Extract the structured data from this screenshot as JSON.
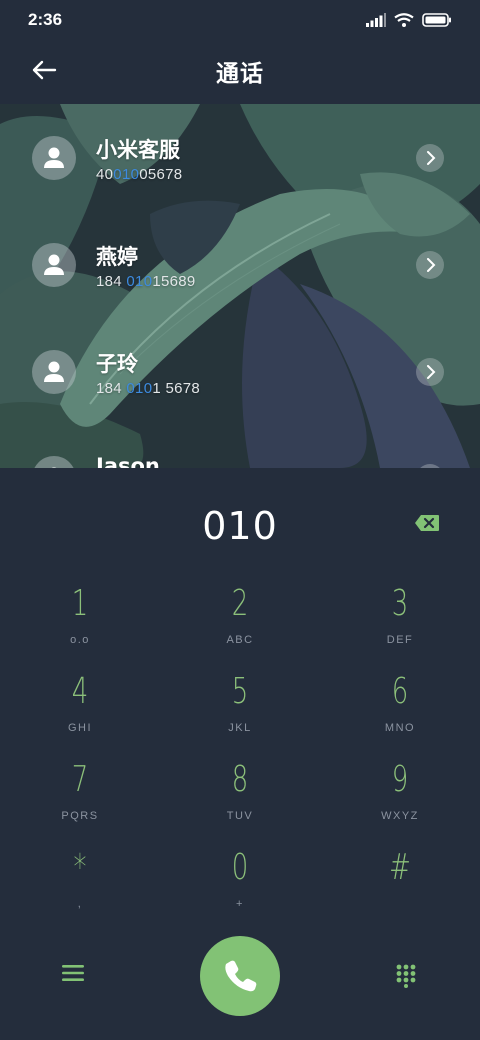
{
  "status_bar": {
    "time": "2:36"
  },
  "header": {
    "title": "通话"
  },
  "contacts": [
    {
      "name": "小米客服",
      "number_pre": "40",
      "number_match": "010",
      "number_post": "05678"
    },
    {
      "name": "燕婷",
      "number_pre": "184 ",
      "number_match": "010",
      "number_post": "15689"
    },
    {
      "name": "子玲",
      "number_pre": "184 ",
      "number_match": "010",
      "number_post": "1 5678"
    },
    {
      "name": "Jason",
      "number_pre": "",
      "number_match": "",
      "number_post": ""
    }
  ],
  "dial": {
    "value": "010"
  },
  "keys": [
    {
      "digit": "1",
      "letters": "ᴏ.ᴏ"
    },
    {
      "digit": "2",
      "letters": "ABC"
    },
    {
      "digit": "3",
      "letters": "DEF"
    },
    {
      "digit": "4",
      "letters": "GHI"
    },
    {
      "digit": "5",
      "letters": "JKL"
    },
    {
      "digit": "6",
      "letters": "MNO"
    },
    {
      "digit": "7",
      "letters": "PQRS"
    },
    {
      "digit": "8",
      "letters": "TUV"
    },
    {
      "digit": "9",
      "letters": "WXYZ"
    },
    {
      "digit": "*",
      "letters": ","
    },
    {
      "digit": "0",
      "letters": "+"
    },
    {
      "digit": "#",
      "letters": ""
    }
  ],
  "colors": {
    "background": "#242d3c",
    "accent_green": "#82c275",
    "match_blue": "#3d8be0"
  },
  "icons": {
    "back": "arrow-left-icon",
    "backspace": "backspace-icon",
    "menu": "menu-icon",
    "call": "phone-icon",
    "keypad": "keypad-icon"
  }
}
